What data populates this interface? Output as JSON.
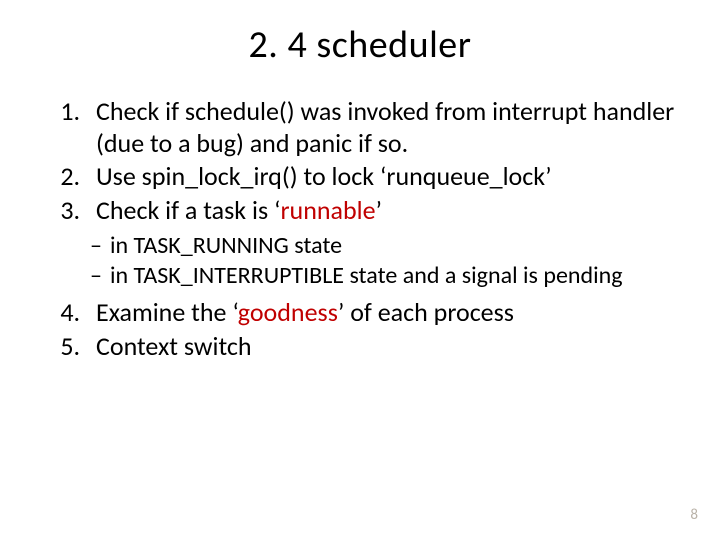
{
  "title": "2. 4 scheduler",
  "items": {
    "i1": "Check if schedule() was invoked from interrupt handler (due to a bug) and panic if so.",
    "i2": "Use spin_lock_irq() to lock ‘runqueue_lock’",
    "i3_prefix": "Check if a task is ‘",
    "i3_hl": "runnable",
    "i3_suffix": "’",
    "i3_sub1": "in TASK_RUNNING state",
    "i3_sub2": "in TASK_INTERRUPTIBLE state and a signal is pending",
    "i4_prefix": "Examine the ‘",
    "i4_hl": "goodness",
    "i4_suffix": "’ of each process",
    "i5": "Context switch"
  },
  "page_number": "8"
}
